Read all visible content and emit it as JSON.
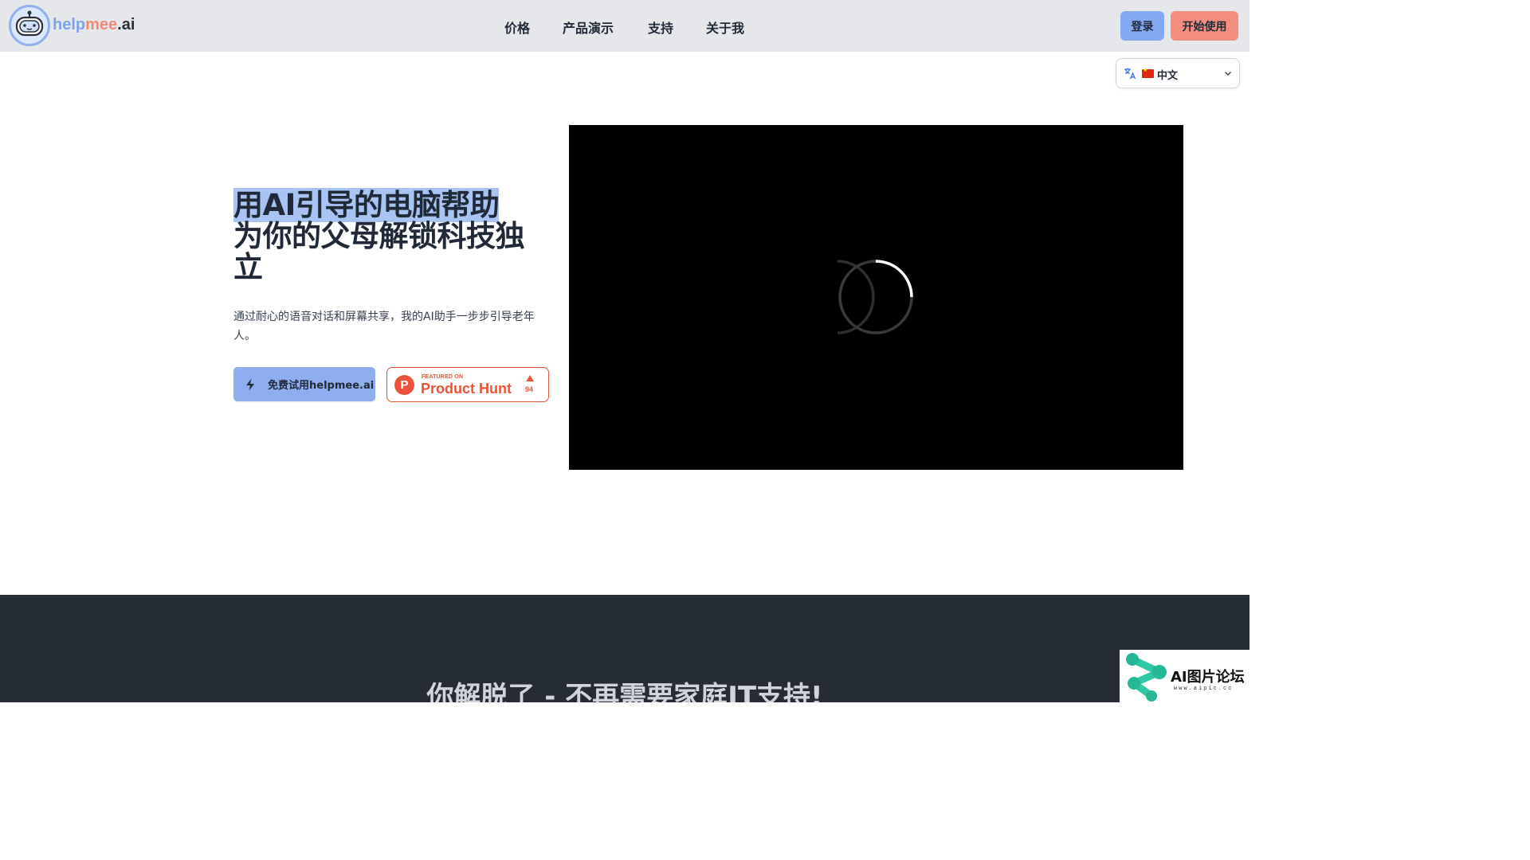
{
  "header": {
    "brand": {
      "part1": "help",
      "part2": "mee",
      "part3": ".ai"
    },
    "nav": [
      "价格",
      "产品演示",
      "支持",
      "关于我"
    ],
    "login_label": "登录",
    "start_label": "开始使用"
  },
  "language": {
    "selected": "中文",
    "flag": "china-flag-icon"
  },
  "hero": {
    "title_line1": "用AI引导的电脑帮助",
    "title_rest": "为你的父母解锁科技独立",
    "description": "通过耐心的语音对话和屏幕共享，我的AI助手一步步引导老年人。",
    "try_button": "免费试用helpmee.ai",
    "producthunt": {
      "small": "FEATURED ON",
      "big": "Product Hunt",
      "count": "94"
    }
  },
  "section2": {
    "title": "你解脱了 - 不再需要家庭IT支持!"
  },
  "watermark": {
    "title": "AI图片论坛",
    "sub": "www.aipic.cc"
  },
  "colors": {
    "header_bg": "#e5e7eb",
    "accent_blue": "#8eafee",
    "accent_coral": "#f48d7d",
    "producthunt": "#ea5337",
    "dark_section": "#262c36"
  }
}
